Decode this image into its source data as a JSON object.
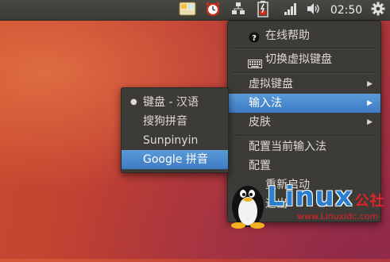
{
  "panel": {
    "clock": "02:50",
    "icons": [
      "input-method-icon",
      "alarm-clock-icon",
      "network-icon",
      "battery-icon",
      "signal-icon",
      "volume-icon",
      "gear-icon"
    ]
  },
  "main_menu": {
    "items": [
      {
        "label": "在线帮助",
        "icon": "help-icon"
      },
      {
        "label": "切换虚拟键盘",
        "icon": "keyboard-icon"
      },
      {
        "label": "虚拟键盘",
        "submenu": true
      },
      {
        "label": "输入法",
        "submenu": true,
        "highlighted": true
      },
      {
        "label": "皮肤",
        "submenu": true
      },
      {
        "label": "配置当前输入法"
      },
      {
        "label": "配置"
      },
      {
        "label": "重新启动"
      },
      {
        "label": "退出"
      }
    ]
  },
  "sub_menu": {
    "items": [
      {
        "label": "键盘 - 汉语",
        "selected": true
      },
      {
        "label": "搜狗拼音"
      },
      {
        "label": "Sunpinyin"
      },
      {
        "label": "Google 拼音",
        "highlighted": true
      }
    ]
  },
  "watermark": {
    "brand": "Linux",
    "suffix": "公社",
    "url": "www.Linuxidc.com"
  },
  "colors": {
    "panel": "#3c3b37",
    "menu_bg": "#3c3b37",
    "highlight": "#4a8ad0",
    "watermark_blue": "#2b7fd0",
    "watermark_red": "#e0232a"
  }
}
